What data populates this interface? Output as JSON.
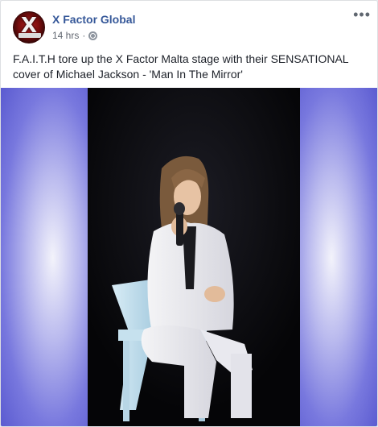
{
  "post": {
    "page_name": "X Factor Global",
    "timestamp": "14 hrs",
    "separator": "·",
    "text": "F.A.I.T.H tore up the X Factor Malta stage with their SENSATIONAL cover of Michael Jackson - 'Man In The Mirror'",
    "more_label": "•••"
  },
  "avatar": {
    "letter": "X"
  },
  "icons": {
    "privacy": "globe-icon",
    "menu": "more-options-icon"
  },
  "colors": {
    "link": "#365899",
    "meta": "#616770",
    "text": "#1d2129",
    "stage_glow": "#7878de"
  }
}
